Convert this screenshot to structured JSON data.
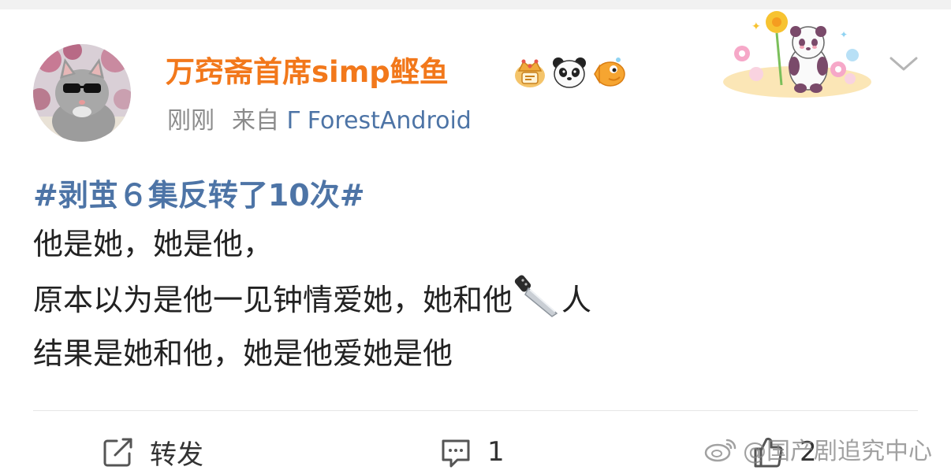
{
  "post": {
    "author": {
      "name": "万窍斋首席simp鲣鱼"
    },
    "badges": [
      "crown-badge-icon",
      "panda-badge-icon",
      "fish-badge-icon"
    ],
    "meta": {
      "time": "刚刚",
      "source_prefix": "来自",
      "source": "Γ ForestAndroid"
    },
    "content": {
      "topic": "#剥茧６集反转了10次#",
      "lines": [
        "他是她，她是他，",
        "原本以为是他一见钟情爱她，她和他",
        "人",
        "结果是她和他，她是他爱她是他"
      ]
    }
  },
  "actions": {
    "forward_label": "转发",
    "comment_count": "1",
    "like_count": "2"
  },
  "watermark": {
    "text": "@国产剧追究中心"
  },
  "colors": {
    "username": "#f2781b",
    "link": "#4d74a6",
    "meta": "#8b8b8b",
    "text": "#222222"
  }
}
